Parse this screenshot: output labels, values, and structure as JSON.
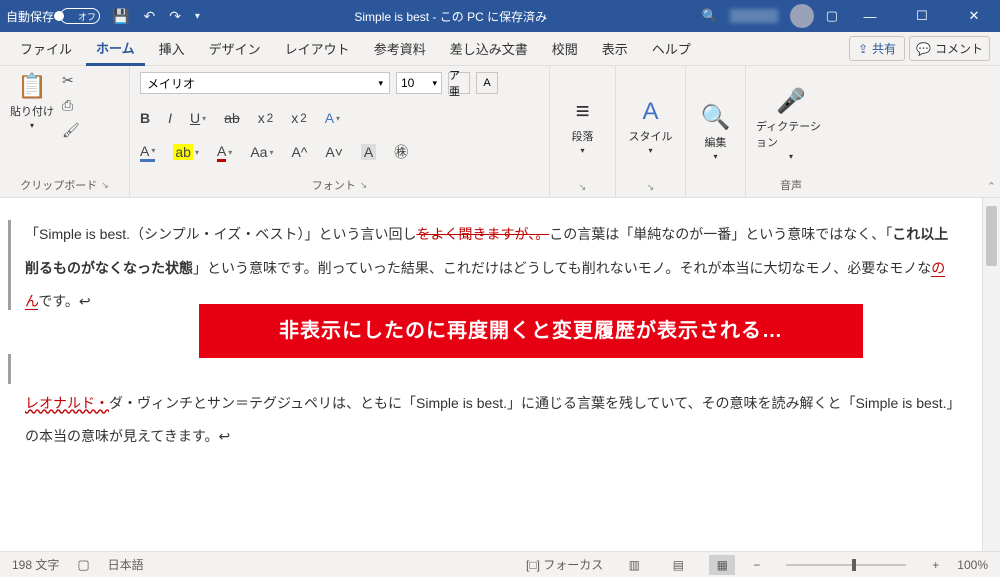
{
  "titlebar": {
    "autosave_label": "自動保存",
    "autosave_state": "オフ",
    "title": "Simple is best - この PC に保存済み"
  },
  "tabs": {
    "file": "ファイル",
    "home": "ホーム",
    "insert": "挿入",
    "design": "デザイン",
    "layout": "レイアウト",
    "references": "参考資料",
    "mailings": "差し込み文書",
    "review": "校閲",
    "view": "表示",
    "help": "ヘルプ",
    "share": "共有",
    "comment": "コメント"
  },
  "ribbon": {
    "clipboard": {
      "paste": "貼り付け",
      "label": "クリップボード"
    },
    "font": {
      "name": "メイリオ",
      "size": "10",
      "ruby": "ア亜",
      "label": "フォント"
    },
    "paragraph": {
      "btn": "段落"
    },
    "styles": {
      "btn": "スタイル"
    },
    "editing": {
      "btn": "編集"
    },
    "voice": {
      "btn": "ディクテーション",
      "label": "音声"
    }
  },
  "document": {
    "p1a": "「Simple is best.（シンプル・イズ・ベスト）」という言い回し",
    "p1_strike": "をよく聞きますが、",
    "p1_strike2": "。",
    "p1b": "この言葉は「単純なのが一番」という意味ではなく、「",
    "p1_bold": "これ以上削るものがなくなった状態",
    "p1c": "」という意味です。削っていった結果、これだけはどうしても削れないモノ。それが本当に大切なモノ、必要なモノな",
    "p1_red": "のん",
    "p1d": "です。↩",
    "p2_red": "レオナルド・",
    "p2a": "ダ・ヴィンチとサン＝テグジュペリは、ともに「Simple is best.」に通じる言葉を残していて、その意味を読み解くと「Simple is best.」の本当の意味が見えてきます。↩"
  },
  "banner": "非表示にしたのに再度開くと変更履歴が表示される…",
  "status": {
    "words": "198 文字",
    "lang": "日本語",
    "focus": "フォーカス",
    "zoom": "100%"
  }
}
